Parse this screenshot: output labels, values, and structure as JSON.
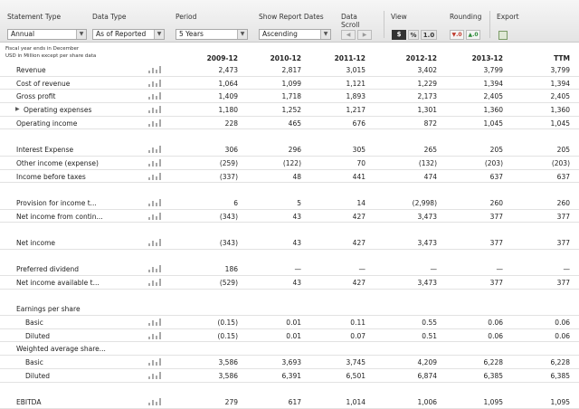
{
  "toolbar": {
    "statement_type": {
      "label": "Statement Type",
      "value": "Annual"
    },
    "data_type": {
      "label": "Data Type",
      "value": "As of Reported"
    },
    "period": {
      "label": "Period",
      "value": "5 Years"
    },
    "show_report_dates": {
      "label": "Show Report Dates",
      "value": "Ascending"
    },
    "data_scroll": {
      "label_line1": "Data",
      "label_line2": "Scroll",
      "left": "◀",
      "right": "▶"
    },
    "view": {
      "label": "View",
      "dollar": "$",
      "percent": "%",
      "one": "1.0"
    },
    "rounding": {
      "label": "Rounding",
      "down": "▼.0",
      "up": "▲.0"
    },
    "export": {
      "label": "Export"
    },
    "dropdown_arrow": "▼"
  },
  "notes": {
    "line1": "Fiscal year ends in December",
    "line2": "USD in Million except per share data"
  },
  "columns": [
    "2009-12",
    "2010-12",
    "2011-12",
    "2012-12",
    "2013-12",
    "TTM"
  ],
  "rows": [
    {
      "label": "Revenue",
      "values": [
        "2,473",
        "2,817",
        "3,015",
        "3,402",
        "3,799",
        "3,799"
      ]
    },
    {
      "label": "Cost of revenue",
      "values": [
        "1,064",
        "1,099",
        "1,121",
        "1,229",
        "1,394",
        "1,394"
      ]
    },
    {
      "label": "Gross profit",
      "values": [
        "1,409",
        "1,718",
        "1,893",
        "2,173",
        "2,405",
        "2,405"
      ]
    },
    {
      "label": "Operating expenses",
      "values": [
        "1,180",
        "1,252",
        "1,217",
        "1,301",
        "1,360",
        "1,360"
      ],
      "expander": "▶"
    },
    {
      "label": "Operating income",
      "values": [
        "228",
        "465",
        "676",
        "872",
        "1,045",
        "1,045"
      ]
    },
    {
      "label": "Interest Expense",
      "values": [
        "306",
        "296",
        "305",
        "265",
        "205",
        "205"
      ]
    },
    {
      "label": "Other income (expense)",
      "values": [
        "(259)",
        "(122)",
        "70",
        "(132)",
        "(203)",
        "(203)"
      ]
    },
    {
      "label": "Income before taxes",
      "values": [
        "(337)",
        "48",
        "441",
        "474",
        "637",
        "637"
      ]
    },
    {
      "label": "Provision for income t...",
      "values": [
        "6",
        "5",
        "14",
        "(2,998)",
        "260",
        "260"
      ]
    },
    {
      "label": "Net income from contin...",
      "values": [
        "(343)",
        "43",
        "427",
        "3,473",
        "377",
        "377"
      ]
    },
    {
      "label": "Net income",
      "values": [
        "(343)",
        "43",
        "427",
        "3,473",
        "377",
        "377"
      ]
    },
    {
      "label": "Preferred dividend",
      "values": [
        "186",
        "—",
        "—",
        "—",
        "—",
        "—"
      ]
    },
    {
      "label": "Net income available t...",
      "values": [
        "(529)",
        "43",
        "427",
        "3,473",
        "377",
        "377"
      ]
    },
    {
      "label": "Earnings per share"
    },
    {
      "label": "Basic",
      "values": [
        "(0.15)",
        "0.01",
        "0.11",
        "0.55",
        "0.06",
        "0.06"
      ]
    },
    {
      "label": "Diluted",
      "values": [
        "(0.15)",
        "0.01",
        "0.07",
        "0.51",
        "0.06",
        "0.06"
      ]
    },
    {
      "label": "Weighted average share..."
    },
    {
      "label": "Basic",
      "values": [
        "3,586",
        "3,693",
        "3,745",
        "4,209",
        "6,228",
        "6,228"
      ]
    },
    {
      "label": "Diluted",
      "values": [
        "3,586",
        "6,391",
        "6,501",
        "6,874",
        "6,385",
        "6,385"
      ]
    },
    {
      "label": "EBITDA",
      "values": [
        "279",
        "617",
        "1,014",
        "1,006",
        "1,095",
        "1,095"
      ]
    }
  ]
}
